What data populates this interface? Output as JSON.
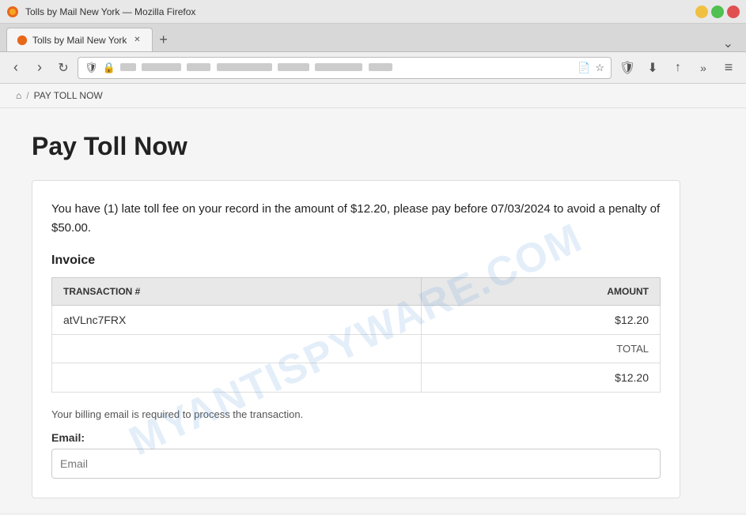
{
  "browser": {
    "title": "Tolls by Mail New York — Mozilla Firefox",
    "tab_label": "Tolls by Mail New York",
    "new_tab_symbol": "+",
    "nav": {
      "back": "‹",
      "forward": "›",
      "refresh": "↻"
    },
    "url": "tollsbymail.ny.gov/pay-toll-now",
    "url_display": "                                                        ",
    "more_symbol": "»",
    "hamburger": "≡",
    "chevron": "⌄"
  },
  "breadcrumb": {
    "home_symbol": "⌂",
    "separator": "/",
    "current": "PAY TOLL NOW"
  },
  "page": {
    "title": "Pay Toll Now",
    "notice": "You have (1) late toll fee on your record in the amount of $12.20, please pay before 07/03/2024 to avoid a penalty of $50.00.",
    "invoice_label": "Invoice",
    "table": {
      "headers": [
        {
          "id": "transaction",
          "label": "TRANSACTION #"
        },
        {
          "id": "amount",
          "label": "AMOUNT"
        }
      ],
      "rows": [
        {
          "transaction": "atVLnc7FRX",
          "amount": "$12.20"
        }
      ],
      "total_label": "TOTAL",
      "total_value": "$12.20"
    },
    "billing_note": "Your billing email is required to process the transaction.",
    "email_label": "Email:",
    "email_placeholder": "Email"
  },
  "watermark": "MYANTISPYWARE.COM"
}
